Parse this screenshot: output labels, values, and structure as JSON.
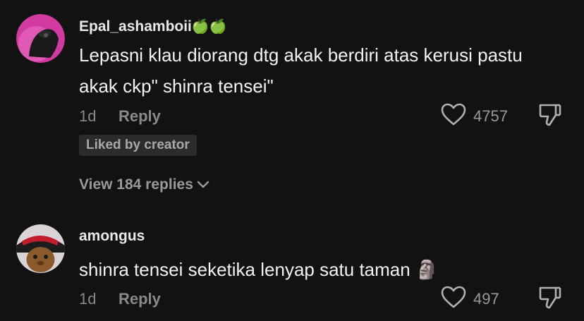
{
  "comments": [
    {
      "username": "Epal_ashamboii",
      "username_emoji": "🍏🍏",
      "text": "Lepasni klau diorang dtg akak berdiri atas kerusi pastu akak ckp\" shinra tensei\"",
      "time": "1d",
      "reply_label": "Reply",
      "likes": "4757",
      "badge": "Liked by creator",
      "view_replies": "View 184 replies"
    },
    {
      "username": "amongus",
      "text": "shinra tensei seketika lenyap satu taman",
      "text_emoji": "🗿",
      "time": "1d",
      "reply_label": "Reply",
      "likes": "497"
    }
  ],
  "icons": {
    "heart": "heart-icon",
    "dislike": "thumbs-down-icon",
    "chevron": "chevron-down-icon"
  },
  "colors": {
    "background": "#121212",
    "secondary_text": "#8a8a8a",
    "badge_bg": "#2b2b2b"
  }
}
